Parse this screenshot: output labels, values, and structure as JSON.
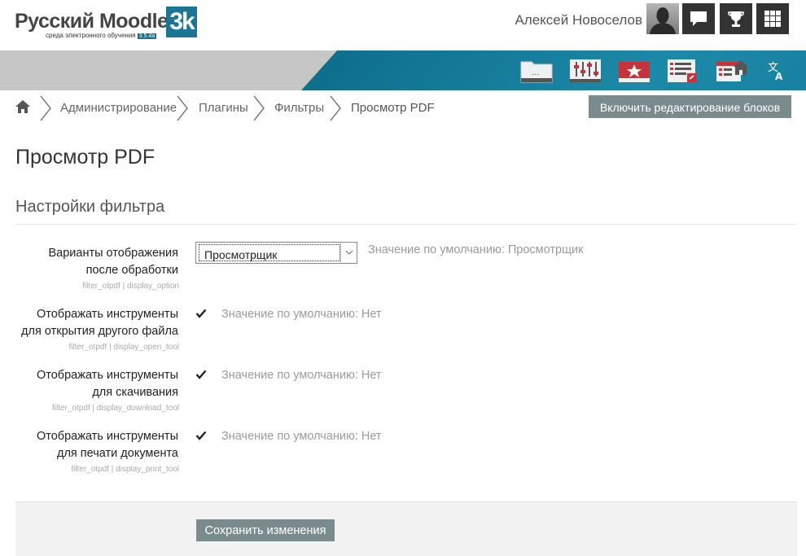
{
  "header": {
    "logo_text": "Русский Moodle",
    "logo_badge": "3k",
    "logo_subtitle": "среда электронного обучения",
    "logo_version": "3.5.4a",
    "username": "Алексей Новоселов",
    "buttons": [
      "chat-icon",
      "trophy-icon",
      "apps-grid-icon"
    ]
  },
  "toolbar": {
    "icons": [
      "folder-icon",
      "sliders-icon",
      "star-badge-icon",
      "report-icon",
      "home-page-icon",
      "language-icon"
    ]
  },
  "breadcrumb": {
    "items": [
      "Администрирование",
      "Плагины",
      "Фильтры",
      "Просмотр PDF"
    ]
  },
  "edit_blocks_label": "Включить редактирование блоков",
  "page_title": "Просмотр PDF",
  "section_title": "Настройки фильтра",
  "settings": [
    {
      "label_lines": [
        "Варианты отображения",
        "после обработки"
      ],
      "key": "filter_otpdf | display_option",
      "control": "select",
      "value": "Просмотрщик",
      "default": "Значение по умолчанию: Просмотрщик"
    },
    {
      "label_lines": [
        "Отображать инструменты",
        "для открытия другого файла"
      ],
      "key": "filter_otpdf | display_open_tool",
      "control": "checkbox",
      "checked": true,
      "default": "Значение по умолчанию: Нет"
    },
    {
      "label_lines": [
        "Отображать инструменты",
        "для скачивания"
      ],
      "key": "filter_otpdf | display_download_tool",
      "control": "checkbox",
      "checked": true,
      "default": "Значение по умолчанию: Нет"
    },
    {
      "label_lines": [
        "Отображать инструменты",
        "для печати документа"
      ],
      "key": "filter_otpdf | display_print_tool",
      "control": "checkbox",
      "checked": true,
      "default": "Значение по умолчанию: Нет"
    }
  ],
  "save_label": "Сохранить изменения",
  "colors": {
    "accent_teal": "#157e9e",
    "button_gray": "#7a8b8e",
    "toolbar_red": "#c8323a"
  }
}
